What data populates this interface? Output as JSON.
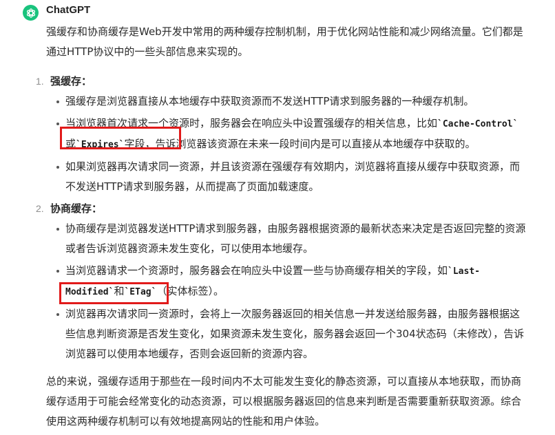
{
  "header": {
    "sender": "ChatGPT",
    "logo_color": "#19c37d"
  },
  "intro": "强缓存和协商缓存是Web开发中常用的两种缓存控制机制，用于优化网站性能和减少网络流量。它们都是通过HTTP协议中的一些头部信息来实现的。",
  "sections": [
    {
      "number": "1.",
      "title": "强缓存：",
      "bullets": [
        {
          "text": "强缓存是浏览器直接从本地缓存中获取资源而不发送HTTP请求到服务器的一种缓存机制。"
        },
        {
          "pre": "当浏览器首次请求一个资源时，服务器会在响应头中设置强缓存的相关信息，比如",
          "code1": "`Cache-Control`",
          "mid": "或",
          "code2": "`Expires`",
          "post": "字段，告诉浏览器该资源在未来一段时间内是可以直接从本地缓存中获取的。"
        },
        {
          "text": "如果浏览器再次请求同一资源，并且该资源在强缓存有效期内，浏览器将直接从缓存中获取资源，而不发送HTTP请求到服务器，从而提高了页面加载速度。"
        }
      ]
    },
    {
      "number": "2.",
      "title": "协商缓存：",
      "bullets": [
        {
          "text": "协商缓存是浏览器发送HTTP请求到服务器，由服务器根据资源的最新状态来决定是否返回完整的资源或者告诉浏览器资源未发生变化，可以使用本地缓存。"
        },
        {
          "pre": "当浏览器请求一个资源时，服务器会在响应头中设置一些与协商缓存相关的字段，如",
          "code1": "`Last-Modified`",
          "mid": "和",
          "code2": "`ETag`",
          "post": "（实体标签）。"
        },
        {
          "text": "浏览器再次请求同一资源时，会将上一次服务器返回的相关信息一并发送给服务器，由服务器根据这些信息判断资源是否发生变化，如果资源未发生变化，服务器会返回一个304状态码（未修改），告诉浏览器可以使用本地缓存，否则会返回新的资源内容。"
        }
      ]
    }
  ],
  "summary": "总的来说，强缓存适用于那些在一段时间内不太可能发生变化的静态资源，可以直接从本地获取，而协商缓存适用于可能会经常变化的动态资源，可以根据服务器返回的信息来判断是否需要重新获取资源。综合使用这两种缓存机制可以有效地提高网站的性能和用户体验。",
  "highlight_color": "#e11a1a"
}
